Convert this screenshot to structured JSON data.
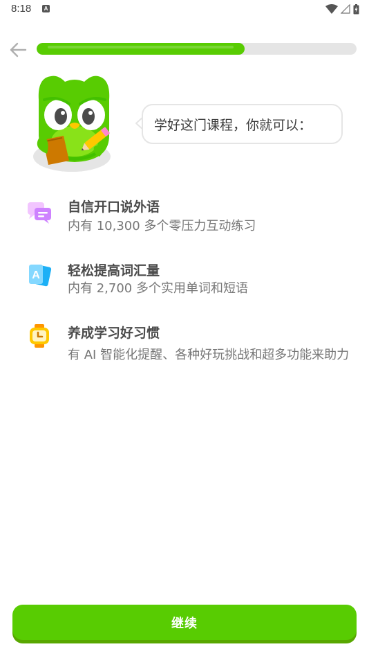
{
  "status_bar": {
    "time": "8:18",
    "notification_badge": "A",
    "icons": [
      "wifi-icon",
      "signal-icon",
      "battery-icon"
    ]
  },
  "header": {
    "back_icon": "arrow-left-icon",
    "progress": 0.65
  },
  "mascot": {
    "icon": "owl-mascot-icon",
    "speech": "学好这门课程，你就可以："
  },
  "benefits": [
    {
      "icon": "chat-bubbles-icon",
      "title": "自信开口说外语",
      "description": "内有 10,300 多个零压力互动练习"
    },
    {
      "icon": "vocabulary-cards-icon",
      "title": "轻松提高词汇量",
      "description": "内有 2,700 多个实用单词和短语"
    },
    {
      "icon": "smartwatch-clock-icon",
      "title": "养成学习好习惯",
      "description": "有 AI 智能化提醒、各种好玩挑战和超多功能来助力"
    }
  ],
  "footer": {
    "continue_label": "继续"
  },
  "colors": {
    "accent": "#58cc02",
    "accent_shadow": "#58a700",
    "track": "#e5e5e5",
    "title_text": "#4b4b4b",
    "desc_text": "#777777"
  }
}
